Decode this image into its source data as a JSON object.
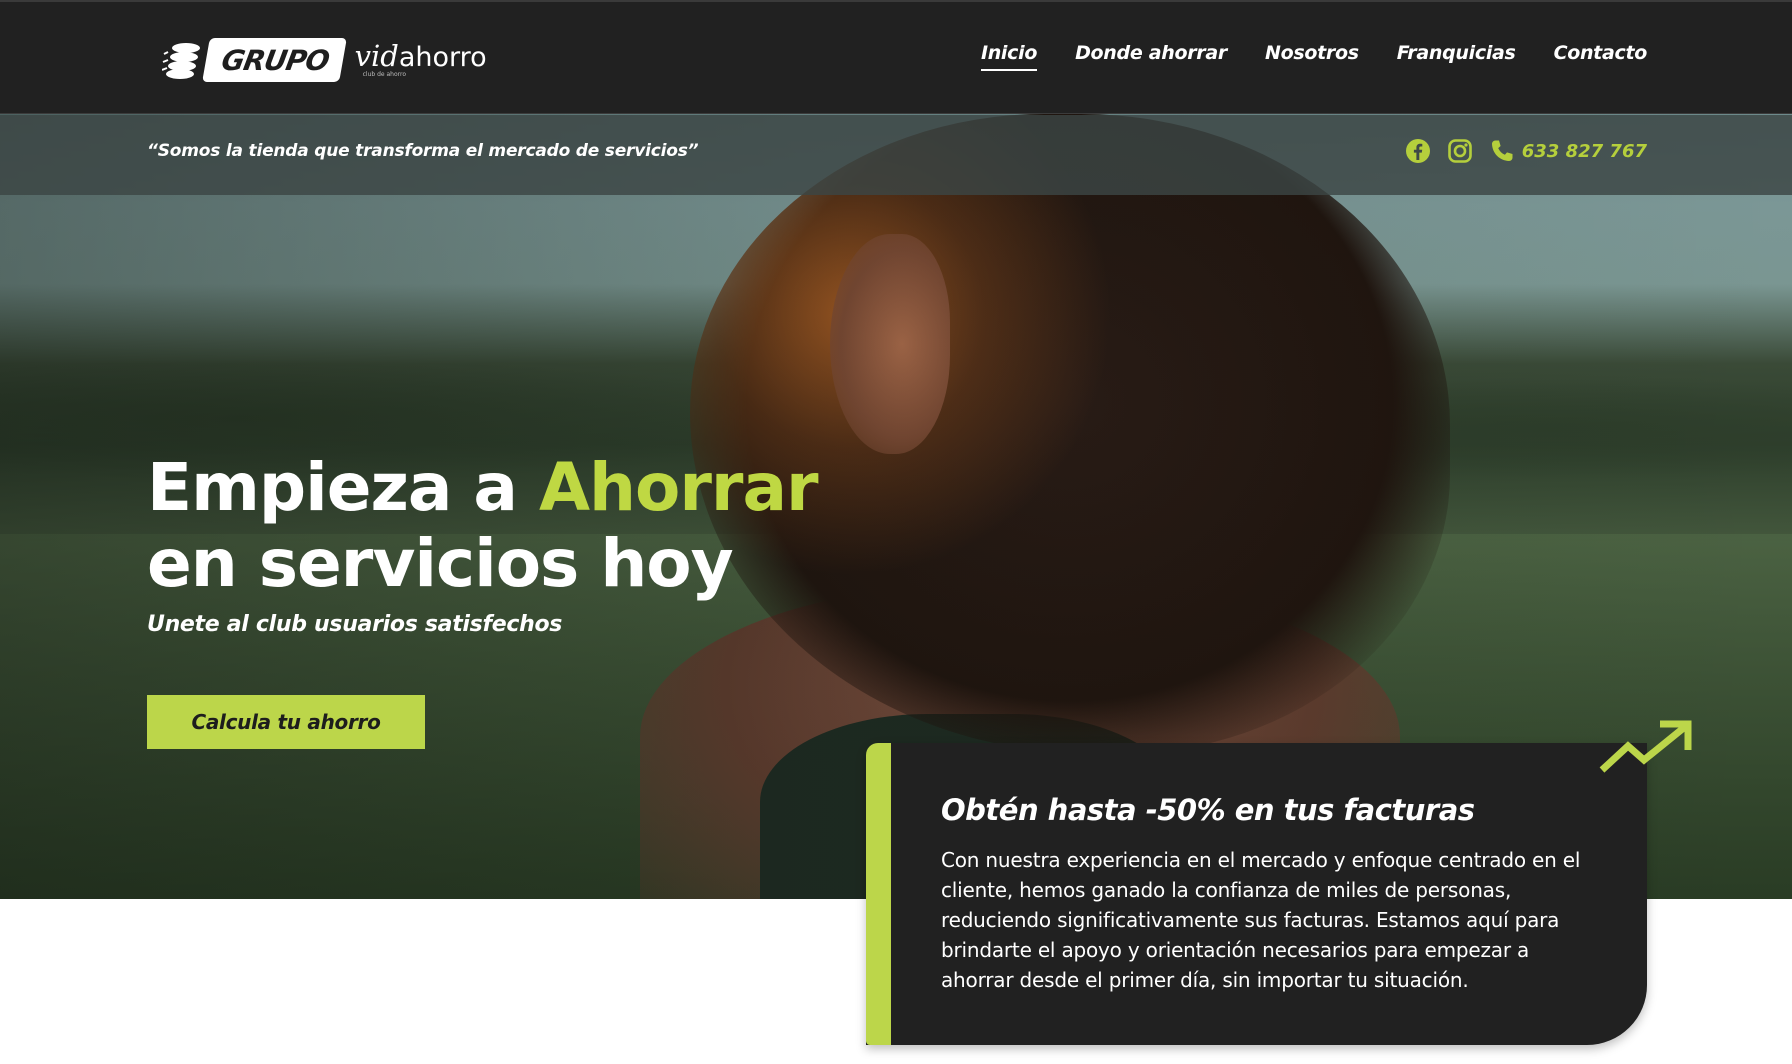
{
  "header": {
    "logo": {
      "box": "GRUPO",
      "script": "vid",
      "word": "ahorro",
      "tag": "club de ahorro"
    },
    "nav": [
      {
        "label": "Inicio",
        "active": true
      },
      {
        "label": "Donde ahorrar",
        "active": false
      },
      {
        "label": "Nosotros",
        "active": false
      },
      {
        "label": "Franquicias",
        "active": false
      },
      {
        "label": "Contacto",
        "active": false
      }
    ]
  },
  "topbar": {
    "tagline": "“Somos la tienda que transforma el mercado de servicios”",
    "icons": [
      "facebook-icon",
      "instagram-icon",
      "phone-icon"
    ],
    "phone": "633 827 767"
  },
  "hero": {
    "title_line1_start": "Empieza a ",
    "title_line1_accent": "Ahorrar",
    "title_line2": "en servicios hoy",
    "subtitle": "Unete al club usuarios satisfechos",
    "cta_label": "Calcula tu ahorro"
  },
  "card": {
    "title": "Obtén hasta -50% en tus facturas",
    "body": "Con nuestra experiencia en el mercado y enfoque centrado en el cliente, hemos ganado la confianza de miles de personas, reduciendo significativamente sus facturas. Estamos aquí para brindarte el apoyo y orientación necesarios para empezar a ahorrar desde el primer día, sin importar tu situación.",
    "icon": "trend-up-icon"
  },
  "colors": {
    "accent": "#bcd64a",
    "dark": "#212121",
    "phone": "#b5cf3c"
  }
}
